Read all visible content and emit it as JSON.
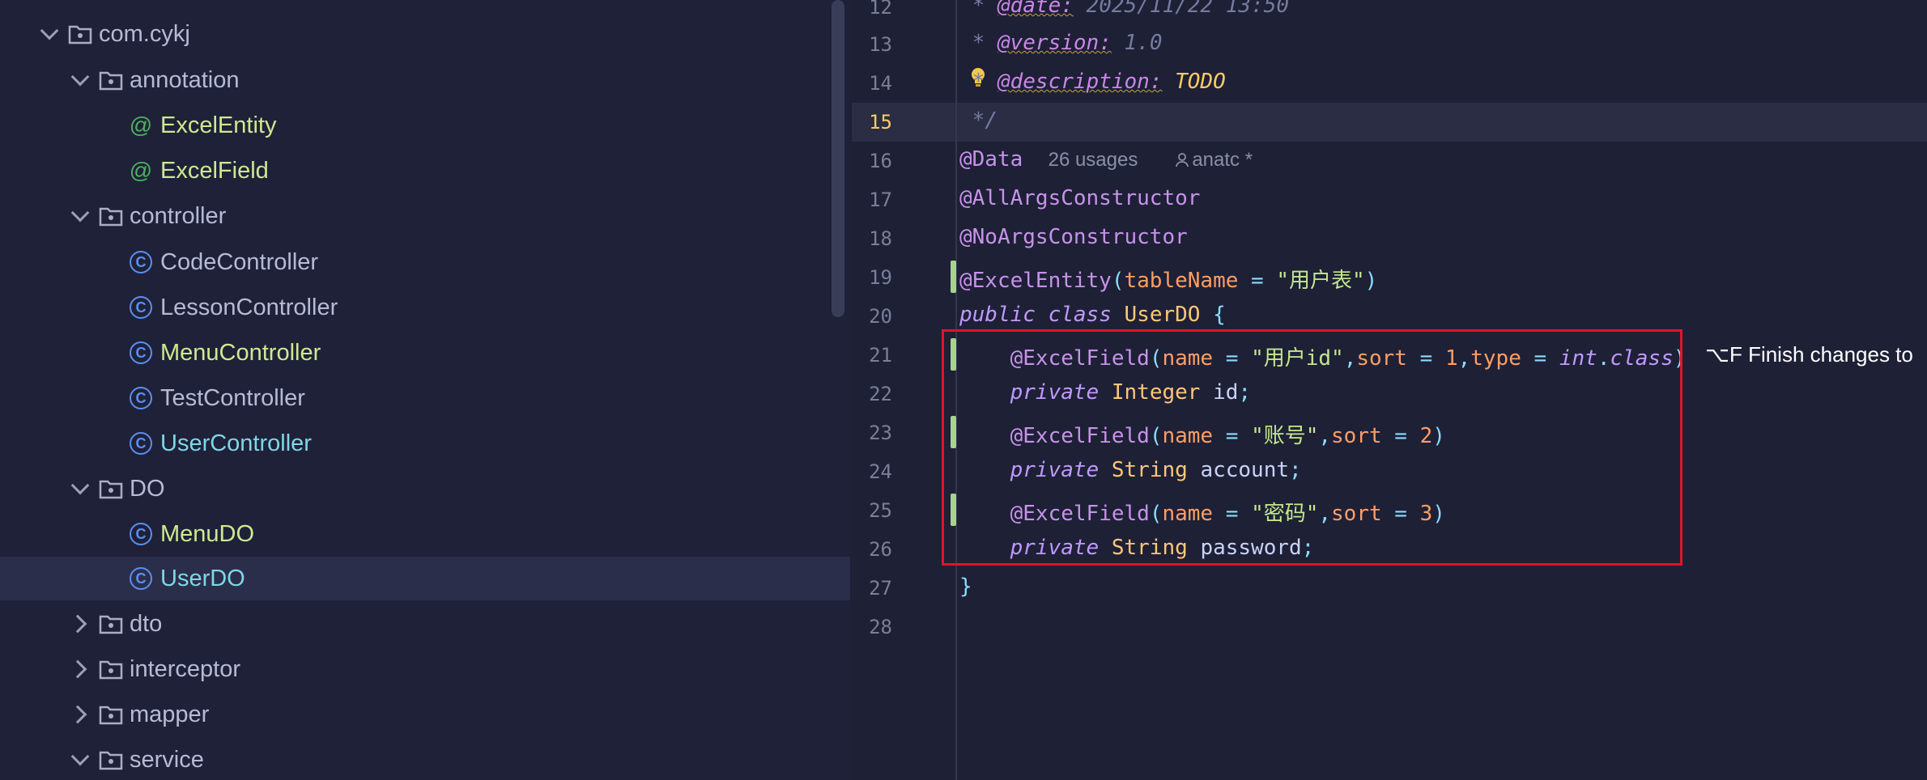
{
  "tree": {
    "rows": [
      {
        "name": "com.cykj",
        "kind": "package",
        "expanded": true
      },
      {
        "name": "annotation",
        "kind": "package",
        "expanded": true
      },
      {
        "name": "ExcelEntity",
        "kind": "annotation"
      },
      {
        "name": "ExcelField",
        "kind": "annotation"
      },
      {
        "name": "controller",
        "kind": "package",
        "expanded": true
      },
      {
        "name": "CodeController",
        "kind": "class"
      },
      {
        "name": "LessonController",
        "kind": "class"
      },
      {
        "name": "MenuController",
        "kind": "class"
      },
      {
        "name": "TestController",
        "kind": "class"
      },
      {
        "name": "UserController",
        "kind": "class"
      },
      {
        "name": "DO",
        "kind": "package",
        "expanded": true
      },
      {
        "name": "MenuDO",
        "kind": "class"
      },
      {
        "name": "UserDO",
        "kind": "class",
        "selected": true
      },
      {
        "name": "dto",
        "kind": "package",
        "expanded": false
      },
      {
        "name": "interceptor",
        "kind": "package",
        "expanded": false
      },
      {
        "name": "mapper",
        "kind": "package",
        "expanded": false
      },
      {
        "name": "service",
        "kind": "package",
        "expanded": true
      }
    ]
  },
  "editor": {
    "line_numbers": [
      "12",
      "13",
      "14",
      "15",
      "16",
      "17",
      "18",
      "19",
      "20",
      "21",
      "22",
      "23",
      "24",
      "25",
      "26",
      "27",
      "28"
    ],
    "current_line": "15",
    "lines": {
      "l12_star": " * ",
      "l12_tag": "@date:",
      "l12_val": " 2025/11/22 13:50",
      "l13_star": " * ",
      "l13_tag": "@version:",
      "l13_val": " 1.0",
      "l14_star": " * ",
      "l14_tag": "@description:",
      "l14_val": " TODO",
      "l15": " */",
      "l16_ann": "@Data",
      "l16_usages": "26 usages",
      "l16_author": "anatc *",
      "l17": "@AllArgsConstructor",
      "l18": "@NoArgsConstructor",
      "l19_ann": "@ExcelEntity",
      "l19_attr": "tableName",
      "l19_str": "\"用户表\"",
      "l20_kw1": "public",
      "l20_kw2": "class",
      "l20_name": "UserDO",
      "l20_brace": "{",
      "l21_ann": "@ExcelField",
      "l21_attr1": "name",
      "l21_str": "\"用户id\"",
      "l21_attr2": "sort",
      "l21_num": "1",
      "l21_attr3": "type",
      "l21_type": "int",
      "l21_cls": "class",
      "l22_kw": "private",
      "l22_type": "Integer",
      "l22_var": "id",
      "l23_ann": "@ExcelField",
      "l23_attr1": "name",
      "l23_str": "\"账号\"",
      "l23_attr2": "sort",
      "l23_num": "2",
      "l24_kw": "private",
      "l24_type": "String",
      "l24_var": "account",
      "l25_ann": "@ExcelField",
      "l25_attr1": "name",
      "l25_str": "\"密码\"",
      "l25_attr2": "sort",
      "l25_num": "3",
      "l26_kw": "private",
      "l26_type": "String",
      "l26_var": "password",
      "l27": "}"
    },
    "ai_hint": "⌥F Finish changes to"
  },
  "colors": {
    "selection_box": "#e0142a",
    "modified_marker": "#a7d38a",
    "current_line_number": "#ffcc66"
  }
}
